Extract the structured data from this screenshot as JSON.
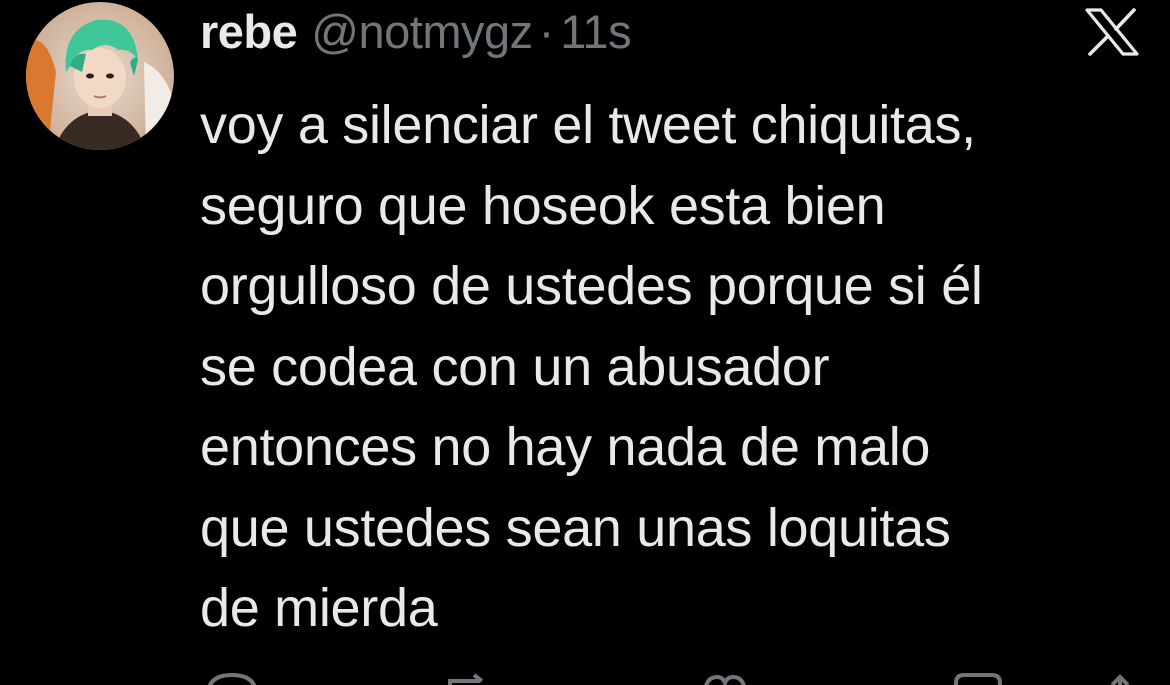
{
  "author": {
    "display_name": "rebe",
    "handle": "@notmygz",
    "separator": "·",
    "timestamp": "11s",
    "avatar_icon": "profile-photo-avatar"
  },
  "platform_icon": "x-logo-icon",
  "tweet": {
    "lines": [
      "voy a silenciar el tweet chiquitas,",
      "seguro que hoseok esta bien",
      "orgulloso de ustedes porque si él",
      "se codea con un abusador",
      "entonces no hay nada de malo",
      "que ustedes sean unas loquitas",
      "de mierda"
    ]
  },
  "actions": [
    {
      "icon": "reply-icon"
    },
    {
      "icon": "retweet-icon"
    },
    {
      "icon": "like-icon"
    },
    {
      "icon": "views-icon"
    },
    {
      "icon": "share-icon"
    }
  ],
  "colors": {
    "background": "#000000",
    "primary_text": "#e7e9ea",
    "secondary_text": "#71767b"
  }
}
